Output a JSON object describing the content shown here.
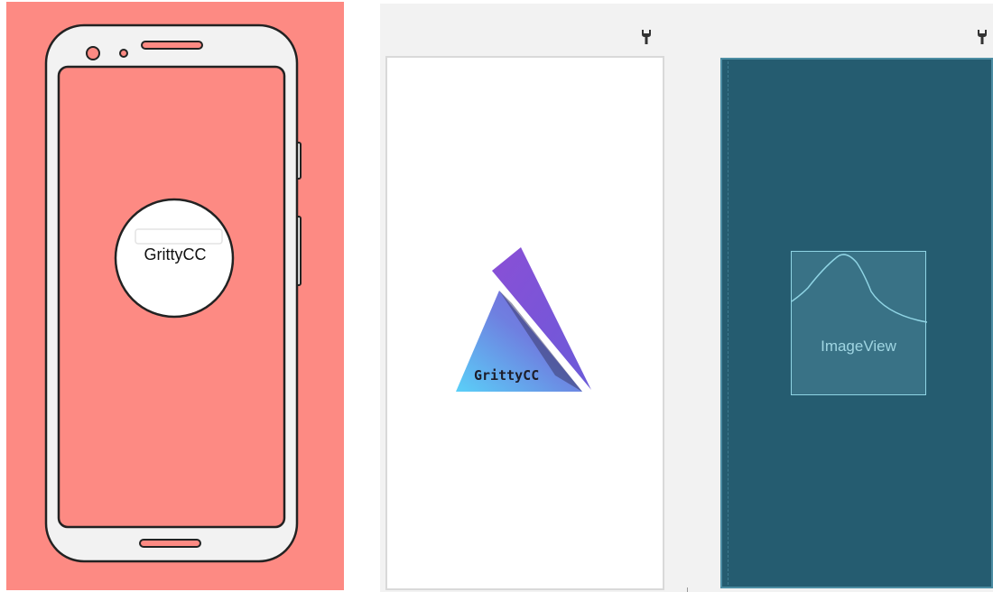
{
  "left_mockup": {
    "app_label": "GrittyCC",
    "background_color": "#fd8a83"
  },
  "editor": {
    "splash_preview": {
      "logo_text": "GrittyCC",
      "logo_colors": [
        "#5ad0f8",
        "#6f6bd8",
        "#8a4fd6"
      ]
    },
    "blueprint": {
      "component_label": "ImageView",
      "background_color": "#255c70"
    },
    "icons": [
      "wrench-icon",
      "wrench-icon"
    ]
  }
}
